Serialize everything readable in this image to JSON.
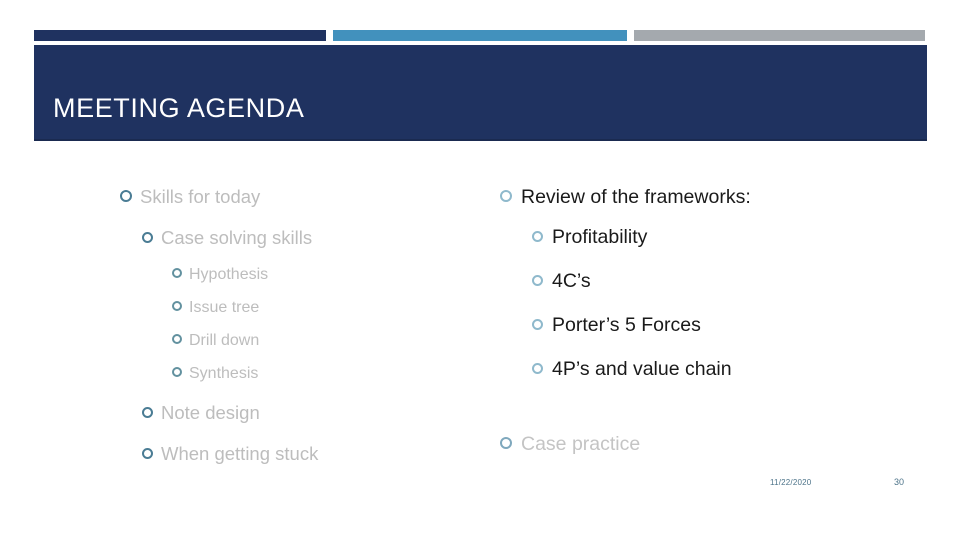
{
  "slide": {
    "title": "MEETING AGENDA",
    "accent_navy": "#1f3260",
    "accent_blue": "#4291bd",
    "accent_gray": "#a4a9ae"
  },
  "left_column": [
    {
      "level": 1,
      "tone": "muted",
      "label": "Skills for today"
    },
    {
      "level": 2,
      "tone": "muted",
      "label": "Case solving skills"
    },
    {
      "level": 3,
      "tone": "muted",
      "label": "Hypothesis"
    },
    {
      "level": 3,
      "tone": "muted",
      "label": "Issue tree"
    },
    {
      "level": 3,
      "tone": "muted",
      "label": "Drill down"
    },
    {
      "level": 3,
      "tone": "muted",
      "label": "Synthesis"
    },
    {
      "level": 2,
      "tone": "muted",
      "label": "Note design"
    },
    {
      "level": 2,
      "tone": "muted",
      "label": "When getting stuck"
    }
  ],
  "right_column": [
    {
      "level": 1,
      "tone": "dark",
      "label": "Review of the frameworks:"
    },
    {
      "level": 2,
      "tone": "dark",
      "label": "Profitability"
    },
    {
      "level": 2,
      "tone": "dark",
      "label": "4C’s"
    },
    {
      "level": 2,
      "tone": "dark",
      "label": "Porter’s 5 Forces"
    },
    {
      "level": 2,
      "tone": "dark",
      "label": "4P’s and value chain"
    },
    {
      "level": 1,
      "tone": "muted",
      "label": "Case practice"
    }
  ],
  "footer": {
    "date": "11/22/2020",
    "page_number": "30"
  }
}
